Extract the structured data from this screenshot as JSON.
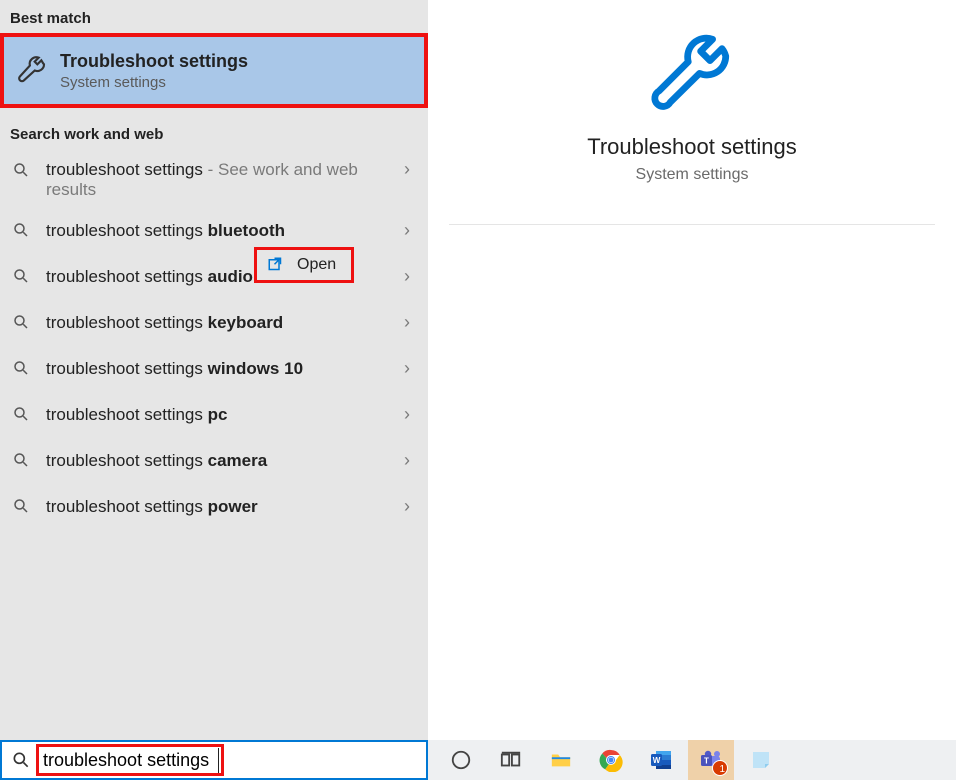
{
  "left": {
    "best_match_header": "Best match",
    "best_match": {
      "title": "Troubleshoot settings",
      "subtitle": "System settings"
    },
    "search_header": "Search work and web",
    "suggestions": [
      {
        "prefix": "troubleshoot settings",
        "bold": "",
        "sub": " - See work and web results"
      },
      {
        "prefix": "troubleshoot settings ",
        "bold": "bluetooth",
        "sub": ""
      },
      {
        "prefix": "troubleshoot settings ",
        "bold": "audio",
        "sub": ""
      },
      {
        "prefix": "troubleshoot settings ",
        "bold": "keyboard",
        "sub": ""
      },
      {
        "prefix": "troubleshoot settings ",
        "bold": "windows 10",
        "sub": ""
      },
      {
        "prefix": "troubleshoot settings ",
        "bold": "pc",
        "sub": ""
      },
      {
        "prefix": "troubleshoot settings ",
        "bold": "camera",
        "sub": ""
      },
      {
        "prefix": "troubleshoot settings ",
        "bold": "power",
        "sub": ""
      }
    ]
  },
  "right": {
    "title": "Troubleshoot settings",
    "subtitle": "System settings",
    "open_label": "Open"
  },
  "searchbox": {
    "value": "troubleshoot settings"
  },
  "taskbar": {
    "icons": [
      "cortana",
      "task-view",
      "file-explorer",
      "chrome",
      "word",
      "teams",
      "sticky-notes"
    ],
    "teams_badge": "1"
  },
  "colors": {
    "accent": "#0078d4",
    "highlight_border": "#e11"
  }
}
